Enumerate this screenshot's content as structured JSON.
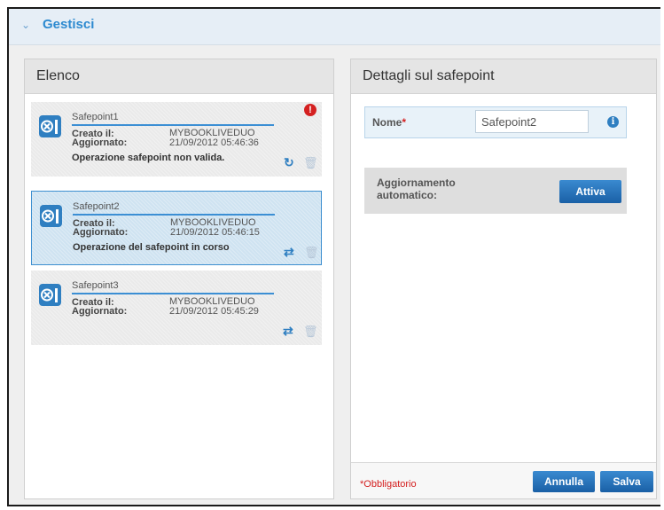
{
  "header": {
    "title": "Gestisci"
  },
  "list_panel": {
    "title": "Elenco",
    "items": [
      {
        "name": "Safepoint1",
        "created_label": "Creato il:",
        "created_value": "MYBOOKLIVEDUO",
        "updated_label": "Aggiornato:",
        "updated_value": "21/09/2012 05:46:36",
        "status": "Operazione safepoint non valida.",
        "error": "!"
      },
      {
        "name": "Safepoint2",
        "created_label": "Creato il:",
        "created_value": "MYBOOKLIVEDUO",
        "updated_label": "Aggiornato:",
        "updated_value": "21/09/2012 05:46:15",
        "status": "Operazione del safepoint in corso"
      },
      {
        "name": "Safepoint3",
        "created_label": "Creato il:",
        "created_value": "MYBOOKLIVEDUO",
        "updated_label": "Aggiornato:",
        "updated_value": "21/09/2012 05:45:29"
      }
    ]
  },
  "details_panel": {
    "title": "Dettagli sul safepoint",
    "name_label": "Nome",
    "required_mark": "*",
    "name_value": "Safepoint2",
    "info_icon": "i",
    "auto_update_label": "Aggiornamento automatico:",
    "activate_button": "Attiva",
    "required_note": "*Obbligatorio",
    "cancel_button": "Annulla",
    "save_button": "Salva"
  },
  "colors": {
    "accent": "#2f7fc1",
    "header_text": "#2d8ad0",
    "error": "#d42020",
    "selected_bg": "#cfe3f1"
  }
}
